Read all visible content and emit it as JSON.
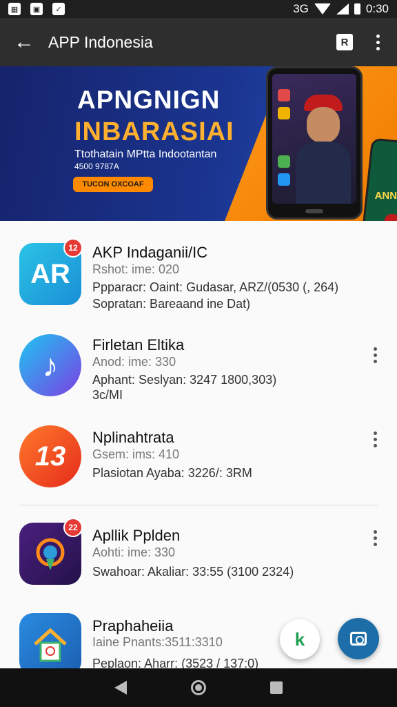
{
  "status_bar": {
    "time": "0:30",
    "network": "3G"
  },
  "app_bar": {
    "title": "APP Indonesia",
    "action_square_label": "R"
  },
  "banner": {
    "headline_1": "APNGNIGN",
    "headline_2": "INBARASIAI",
    "subtitle_1": "Ttothatain MPtta Indootantan",
    "subtitle_2": "4500 9787A",
    "button_label": "TUCON OXCOAF",
    "phone2_text": "ANN"
  },
  "apps": [
    {
      "name": "AKP Indaganii/IC",
      "line1": "Rshot: ime: 020",
      "line2": "Ppparacr: Oaint: Gudasar, ARZ/(0530 (, 264)",
      "line3": "Sopratan: Bareaand ine Dat)",
      "badge": "12",
      "icon_glyph": "AR",
      "icon_color": "#1aa9e0"
    },
    {
      "name": "Firletan Eltika",
      "line1": "Anod: ime: 330",
      "line2": "Aphant: Seslyan: 3247 1800,303)",
      "line3": "3c/MI",
      "icon_glyph": "♪",
      "icon_color": "#3f7be0"
    },
    {
      "name": "Nplinahtrata",
      "line1": "Gsem: ims: 410",
      "line2": "Plasiotan Ayaba: 3226/: 3RM",
      "icon_glyph": "13",
      "icon_color": "#ff5722"
    },
    {
      "name": "Apllik Pplden",
      "line1": "Aohti: ime: 330",
      "line2": "Swahoar: Akaliar: 33:55 (3100 2324)",
      "badge": "22",
      "icon_color": "#3b1a6e"
    },
    {
      "name": "Praphaheiia",
      "line1": "Iaine Pnants:3511:3310",
      "line2": "Peplaon: Aharr: (3523 / 137:0)",
      "icon_color": "#1e6fc0"
    }
  ],
  "fab": {
    "chat_icon": "k"
  }
}
